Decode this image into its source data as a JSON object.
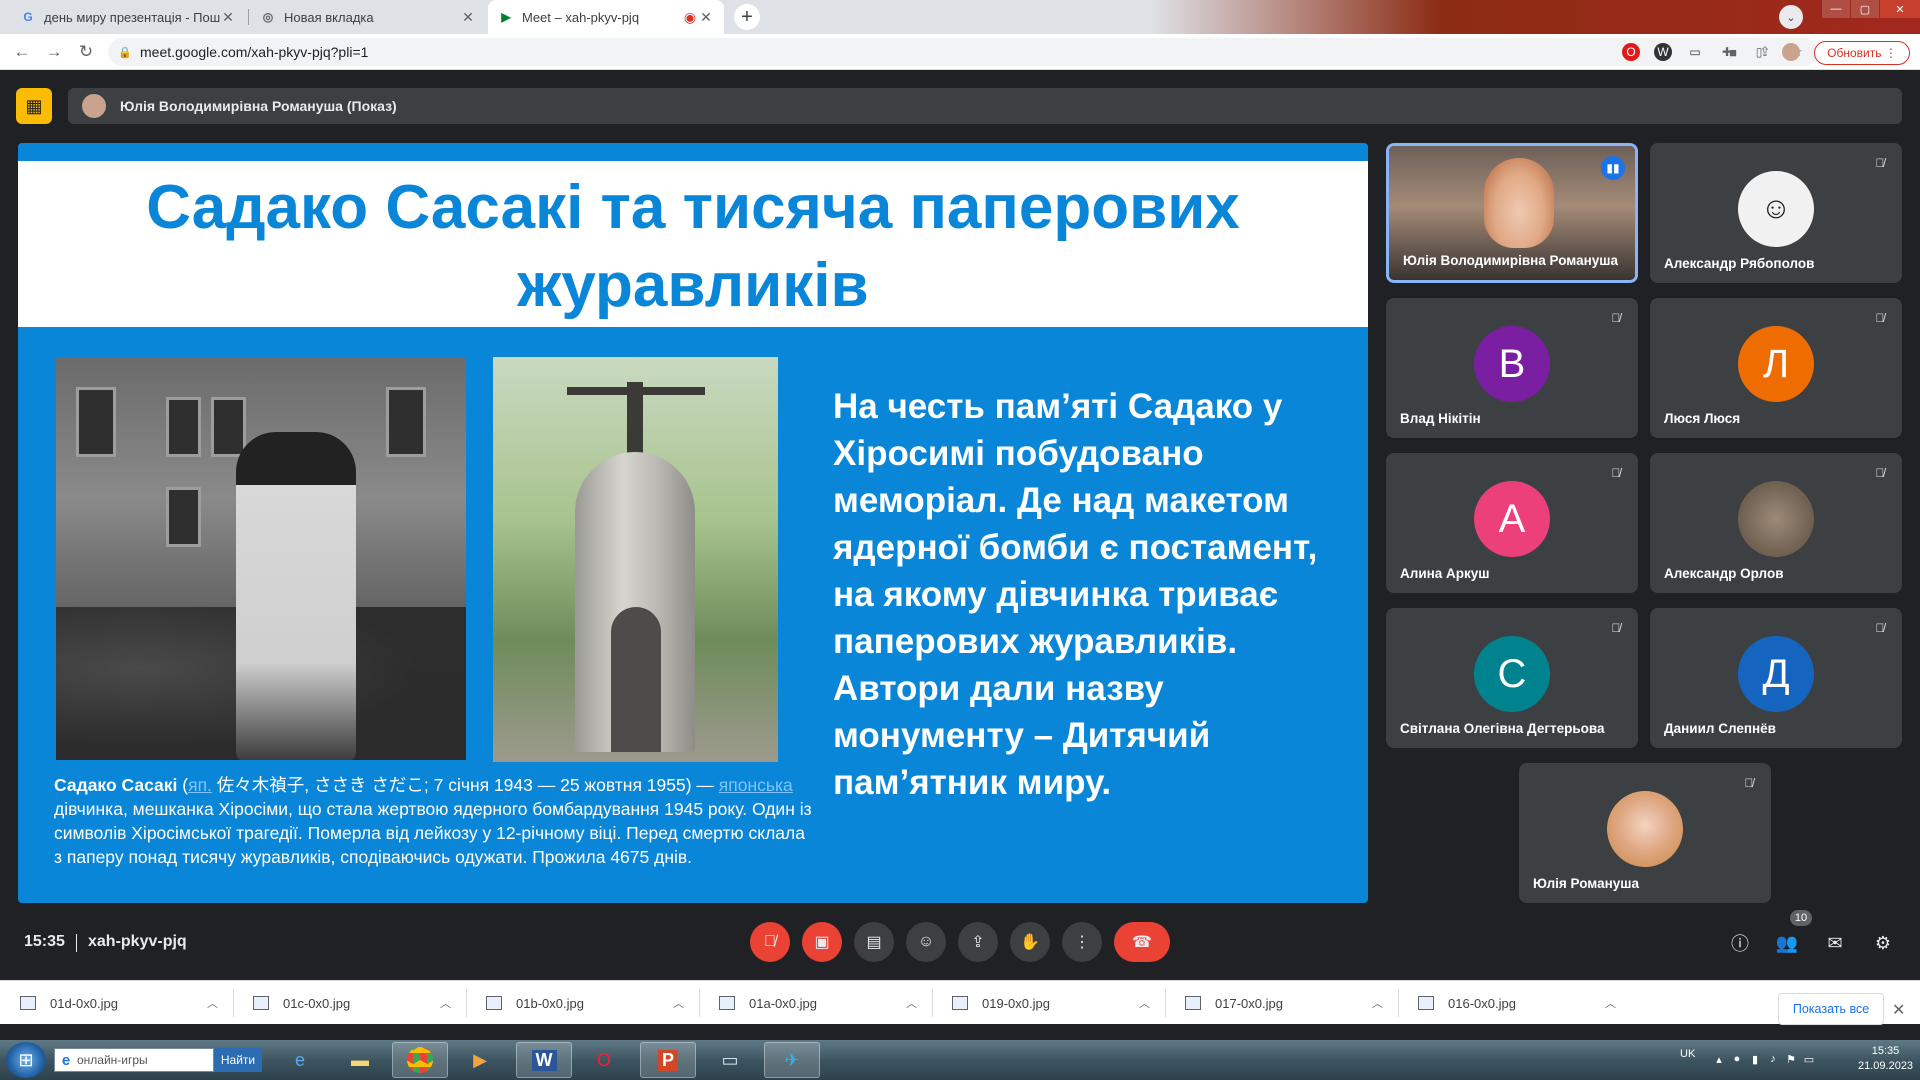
{
  "browser": {
    "tabs": [
      {
        "title": "день миру презентація - Пошук",
        "favicon": "google-g"
      },
      {
        "title": "Новая вкладка",
        "favicon": "chrome-icon"
      },
      {
        "title": "Meet – xah-pkyv-pjq",
        "favicon": "meet-icon",
        "recording": true
      }
    ],
    "url": "meet.google.com/xah-pkyv-pjq?pli=1",
    "update_label": "Обновить"
  },
  "meet": {
    "presenter_label": "Юлія Володимирівна Романуша (Показ)",
    "time": "15:35",
    "meeting_code": "xah-pkyv-pjq",
    "people_count": "10"
  },
  "slide": {
    "title": "Садако Сасакі та тисяча паперових журавликів",
    "caption_name": "Садако Сасакі",
    "caption_link1": "яп.",
    "caption_part1": " 佐々木禎子, ささき さだこ; 7 січня 1943 — 25 жовтня 1955) —",
    "caption_link2": "японська",
    "caption_part2": " дівчинка, мешканка Хіросіми, що стала жертвою ядерного бомбардування 1945 року. Один із символів Хіросімської трагедії. Померла від лейкозу у 12-річному віці. Перед смертю склала з паперу понад тисячу журавликів, сподіваючись одужати. Прожила 4675 днів.",
    "right_text": "На честь пам’яті Садако у Хіросимі побудовано меморіал. Де над макетом ядерної бомби є постамент, на якому дівчинка триває паперових журавликів. Автори дали назву монументу – Дитячий пам’ятник миру."
  },
  "participants": [
    {
      "name": "Юлія Володимирівна Романуша",
      "initial": "",
      "color": "",
      "speaking": true
    },
    {
      "name": "Александр Рябополов",
      "initial": "",
      "color": "#5f6368"
    },
    {
      "name": "Влад Нікітін",
      "initial": "В",
      "color": "#7b1fa2"
    },
    {
      "name": "Люся Люся",
      "initial": "Л",
      "color": "#ef6c00"
    },
    {
      "name": "Алина Аркуш",
      "initial": "А",
      "color": "#ec407a"
    },
    {
      "name": "Александр Орлов",
      "initial": "",
      "color": "#6d5e4f"
    },
    {
      "name": "Світлана Олегівна Дегтерьова",
      "initial": "С",
      "color": "#00838f"
    },
    {
      "name": "Даниил Слепнёв",
      "initial": "Д",
      "color": "#1565c0"
    },
    {
      "name": "Юлія Романуша",
      "initial": "",
      "color": "#d8b3a0"
    }
  ],
  "downloads": {
    "files": [
      "01d-0x0.jpg",
      "01c-0x0.jpg",
      "01b-0x0.jpg",
      "01a-0x0.jpg",
      "019-0x0.jpg",
      "017-0x0.jpg",
      "016-0x0.jpg"
    ],
    "show_all": "Показать все"
  },
  "taskbar": {
    "search_placeholder": "онлайн-игры",
    "search_button": "Найти",
    "lang": "UK",
    "time": "15:35",
    "date": "21.09.2023"
  }
}
